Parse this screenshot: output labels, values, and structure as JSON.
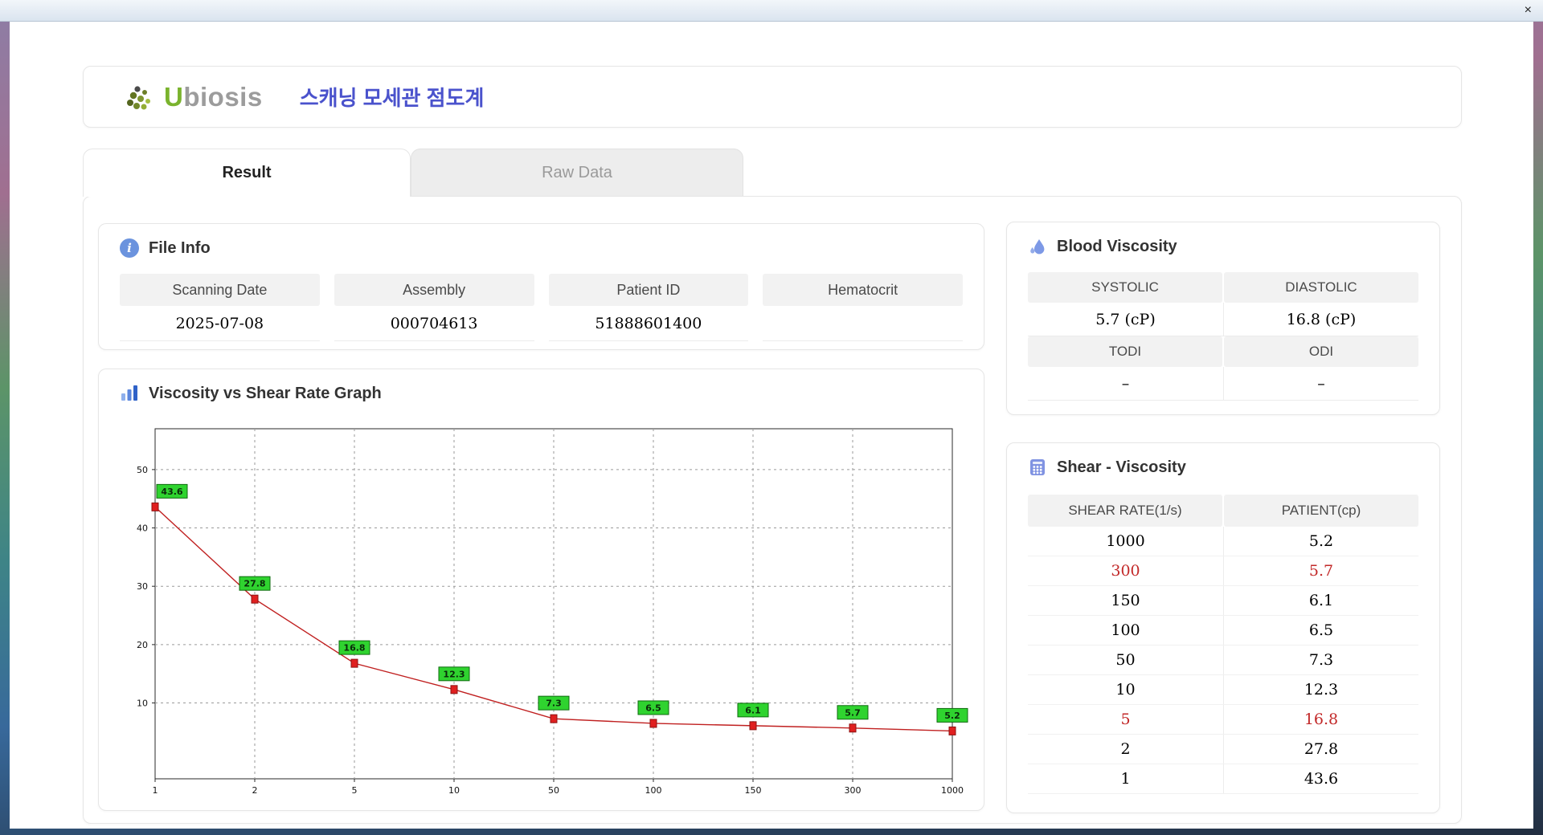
{
  "window": {
    "title_bar": {
      "close_icon": "×"
    }
  },
  "header": {
    "logo": {
      "icon": "leaf-dots-icon",
      "text_u": "U",
      "text_rest": "biosis"
    },
    "app_title": "스캐닝 모세관 점도계"
  },
  "tabs": [
    {
      "id": "result",
      "label": "Result",
      "active": true
    },
    {
      "id": "raw-data",
      "label": "Raw Data",
      "active": false
    }
  ],
  "file_info": {
    "icon": "info-icon",
    "title": "File Info",
    "fields": [
      {
        "label": "Scanning Date",
        "value": "2025-07-08"
      },
      {
        "label": "Assembly",
        "value": "000704613"
      },
      {
        "label": "Patient ID",
        "value": "51888601400"
      },
      {
        "label": "Hematocrit",
        "value": ""
      }
    ]
  },
  "graph": {
    "icon": "bar-chart-icon",
    "title": "Viscosity vs Shear Rate Graph"
  },
  "chart_data": {
    "type": "line",
    "title": "Viscosity vs Shear Rate Graph",
    "x": [
      1,
      2,
      5,
      10,
      50,
      100,
      150,
      300,
      1000
    ],
    "x_scale": "categorical-evenly-spaced",
    "series": [
      {
        "name": "PATIENT (cp)",
        "values": [
          43.6,
          27.8,
          16.8,
          12.3,
          7.3,
          6.5,
          6.1,
          5.7,
          5.2
        ]
      }
    ],
    "point_labels": [
      "43.6",
      "27.8",
      "16.8",
      "12.3",
      "7.3",
      "6.5",
      "6.1",
      "5.7",
      "5.2"
    ],
    "yticks": [
      10,
      20,
      30,
      40,
      50
    ],
    "ylim": [
      -3,
      57
    ],
    "grid": "dashed",
    "legend": "none",
    "line_color": "#c02020",
    "marker_color": "#e02020",
    "point_label_bg": "#2fd32f"
  },
  "blood_viscosity": {
    "icon": "droplets-icon",
    "title": "Blood Viscosity",
    "rows": [
      [
        {
          "label": "SYSTOLIC",
          "value": "5.7 (cP)"
        },
        {
          "label": "DIASTOLIC",
          "value": "16.8 (cP)"
        }
      ],
      [
        {
          "label": "TODI",
          "value": "–"
        },
        {
          "label": "ODI",
          "value": "–"
        }
      ]
    ]
  },
  "shear_viscosity": {
    "icon": "calculator-grid-icon",
    "title": "Shear - Viscosity",
    "columns": [
      "SHEAR RATE(1/s)",
      "PATIENT(cp)"
    ],
    "highlight_color": "#c22828",
    "rows": [
      {
        "shear_rate": "1000",
        "patient": "5.2",
        "highlight": false
      },
      {
        "shear_rate": "300",
        "patient": "5.7",
        "highlight": true
      },
      {
        "shear_rate": "150",
        "patient": "6.1",
        "highlight": false
      },
      {
        "shear_rate": "100",
        "patient": "6.5",
        "highlight": false
      },
      {
        "shear_rate": "50",
        "patient": "7.3",
        "highlight": false
      },
      {
        "shear_rate": "10",
        "patient": "12.3",
        "highlight": false
      },
      {
        "shear_rate": "5",
        "patient": "16.8",
        "highlight": true
      },
      {
        "shear_rate": "2",
        "patient": "27.8",
        "highlight": false
      },
      {
        "shear_rate": "1",
        "patient": "43.6",
        "highlight": false
      }
    ]
  },
  "colors": {
    "accent_blue": "#4a52cc",
    "icon_blue": "#7d99e6",
    "tab_inactive_bg": "#ededed",
    "cell_header_bg": "#f2f2f2",
    "highlight_red": "#c22828"
  }
}
